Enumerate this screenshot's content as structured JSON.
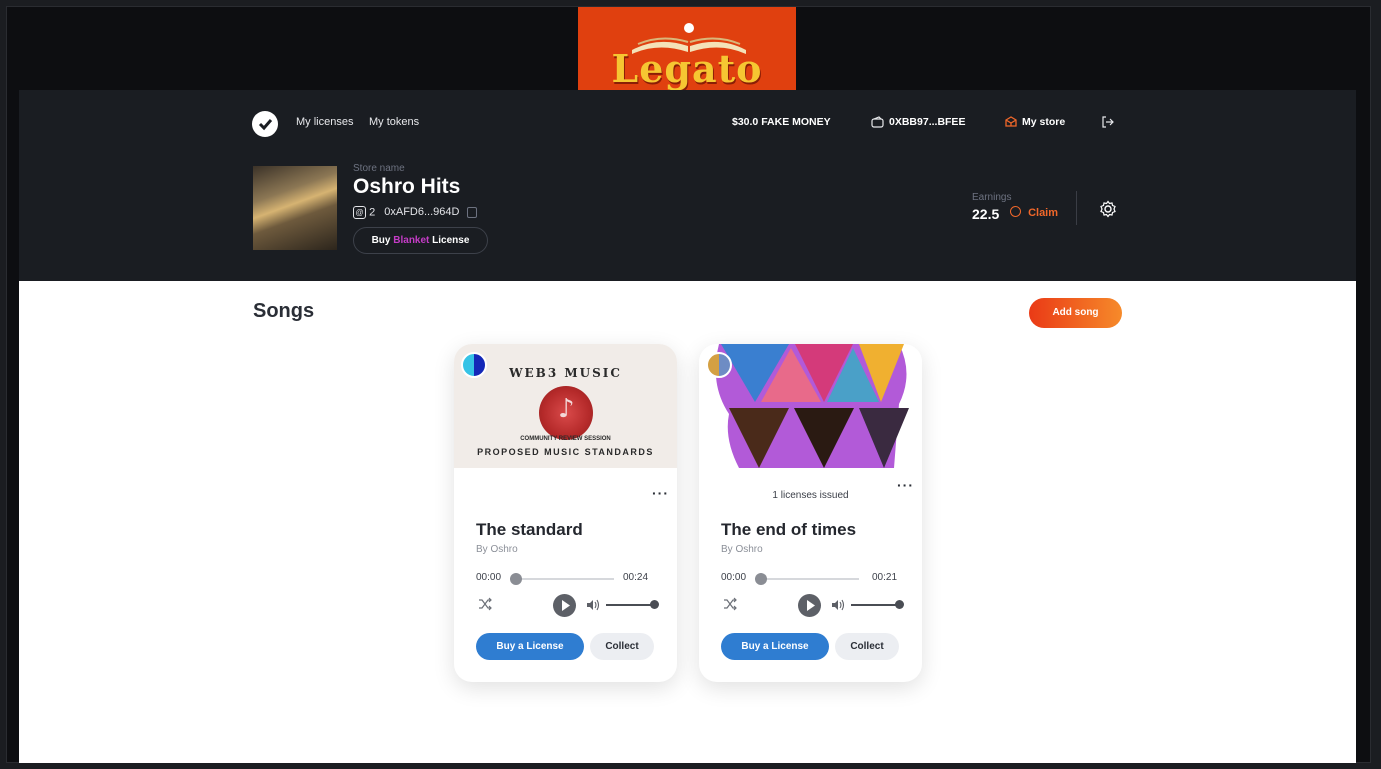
{
  "brand": {
    "name": "Legato",
    "color": "#e0400f",
    "text_color": "#f6c632"
  },
  "nav": {
    "links": [
      "My licenses",
      "My tokens"
    ],
    "balance": "$30.0 FAKE MONEY",
    "wallet": "0XBB97...BFEE",
    "store": "My store",
    "icons": [
      "legato-logo-icon",
      "wallet-icon",
      "store-icon",
      "logout-icon"
    ]
  },
  "store": {
    "label": "Store name",
    "name": "Oshro Hits",
    "count": "2",
    "address": "0xAFD6...964D",
    "blanket_prefix": "Buy",
    "blanket_highlight": "Blanket",
    "blanket_suffix": "License"
  },
  "earnings": {
    "label": "Earnings",
    "value": "22.5",
    "claim": "Claim"
  },
  "songs": {
    "title": "Songs",
    "add_label": "Add song",
    "cards": [
      {
        "art_line1": "WEB3 MUSIC",
        "art_line2": "COMMUNITY REVIEW SESSION",
        "art_line3": "PROPOSED MUSIC STANDARDS",
        "issued": "",
        "title": "The standard",
        "by": "By Oshro",
        "time_start": "00:00",
        "time_end": "00:24",
        "buy_label": "Buy a License",
        "collect_label": "Collect"
      },
      {
        "issued": "1 licenses issued",
        "title": "The end of times",
        "by": "By Oshro",
        "time_start": "00:00",
        "time_end": "00:21",
        "buy_label": "Buy a License",
        "collect_label": "Collect"
      }
    ]
  },
  "colors": {
    "accent": "#f0672a",
    "primary_button": "#2f7dd1",
    "header_bg": "#1a1d22"
  }
}
